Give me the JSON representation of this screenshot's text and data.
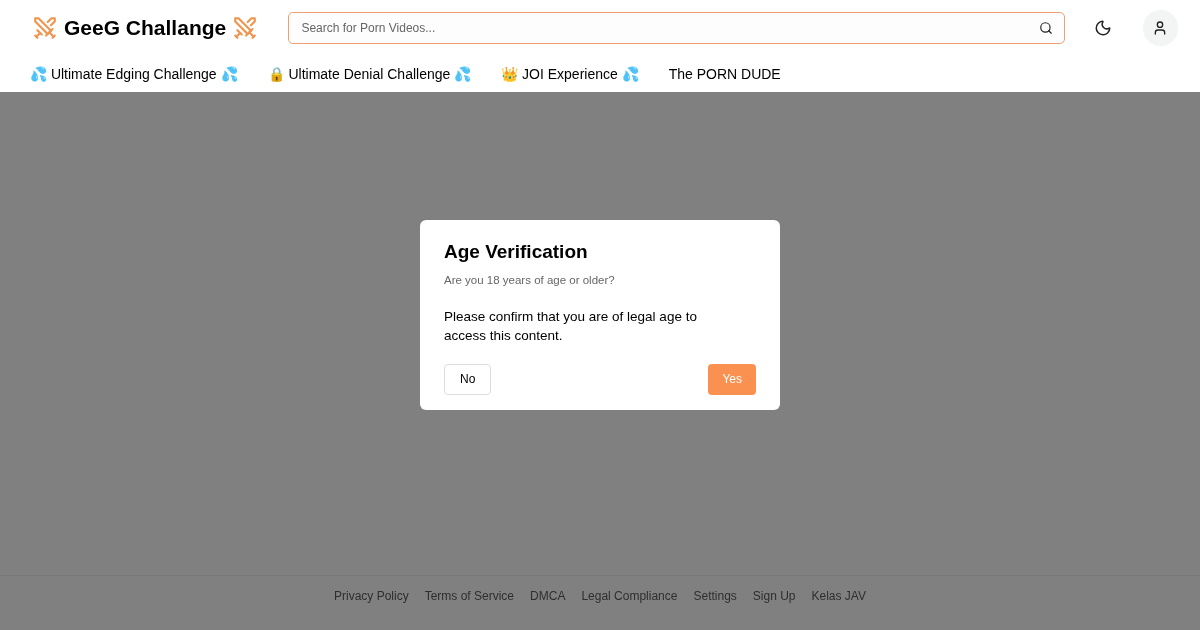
{
  "header": {
    "logo": "GeeG Challange",
    "search": {
      "placeholder": "Search for Porn Videos..."
    }
  },
  "nav": [
    "💦 Ultimate Edging Challenge 💦",
    "🔒 Ultimate Denial Challenge 💦",
    "👑 JOI Experience 💦",
    "The PORN DUDE"
  ],
  "dialog": {
    "title": "Age Verification",
    "subtitle": "Are you 18 years of age or older?",
    "message": "Please confirm that you are of legal age to access this content.",
    "buttons": [
      {
        "label": "No",
        "kind": "outline"
      },
      {
        "label": "Yes",
        "kind": "primary"
      }
    ]
  },
  "footer": [
    "Privacy Policy",
    "Terms of Service",
    "DMCA",
    "Legal Compliance",
    "Settings",
    "Sign Up",
    "Kelas JAV"
  ]
}
